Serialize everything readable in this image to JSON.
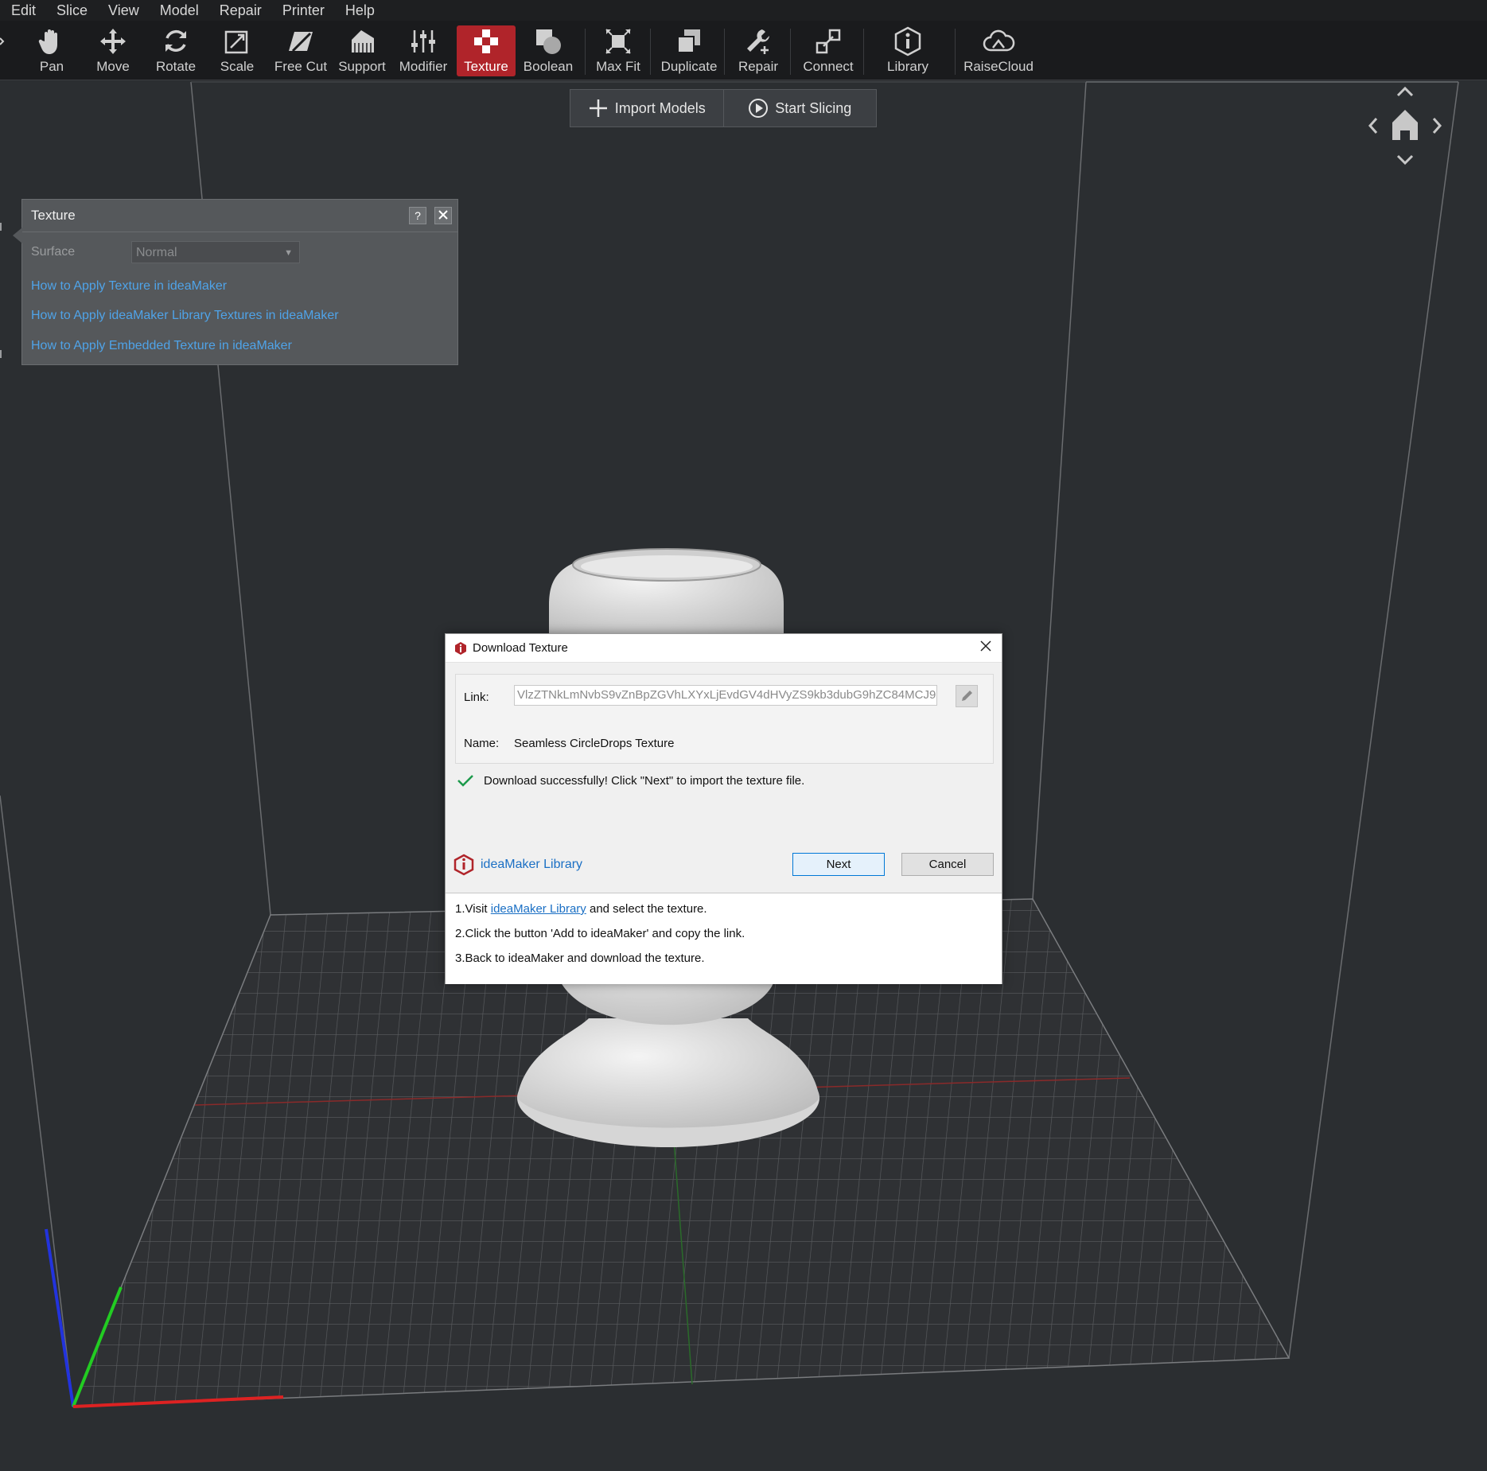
{
  "menu": [
    "Edit",
    "Slice",
    "View",
    "Model",
    "Repair",
    "Printer",
    "Help"
  ],
  "toolbar": {
    "active": "Texture",
    "tools": [
      "Pan",
      "Move",
      "Rotate",
      "Scale",
      "Free Cut",
      "Support",
      "Modifier",
      "Texture",
      "Boolean",
      "Max Fit",
      "Duplicate",
      "Repair",
      "Connect",
      "Library",
      "RaiseCloud"
    ]
  },
  "actions": {
    "import": "Import Models",
    "slice": "Start Slicing"
  },
  "texture_panel": {
    "title": "Texture",
    "help": "?",
    "surface_label": "Surface",
    "surface_value": "Normal",
    "links": [
      "How to Apply Texture in ideaMaker",
      "How to Apply ideaMaker Library Textures in ideaMaker",
      "How to Apply Embedded Texture in ideaMaker"
    ]
  },
  "dialog": {
    "title": "Download Texture",
    "link_label": "Link:",
    "link_value": "VlzZTNkLmNvbS9vZnBpZGVhLXYxLjEvdGV4dHVyZS9kb3dubG9hZC84MCJ9",
    "name_label": "Name:",
    "name_value": "Seamless CircleDrops Texture",
    "status": "Download successfully! Click \"Next\" to import the texture file.",
    "library_label": "ideaMaker Library",
    "next": "Next",
    "cancel": "Cancel",
    "instructions": {
      "step1_pre": "1.Visit ",
      "step1_link": "ideaMaker Library",
      "step1_post": " and select the texture.",
      "step2": "2.Click the button 'Add to ideaMaker' and copy the link.",
      "step3": "3.Back to ideaMaker and download the texture."
    }
  },
  "colors": {
    "accent": "#b0242a",
    "link": "#4fa3e8",
    "background": "#2b2e31",
    "success": "#1c9a4b"
  }
}
